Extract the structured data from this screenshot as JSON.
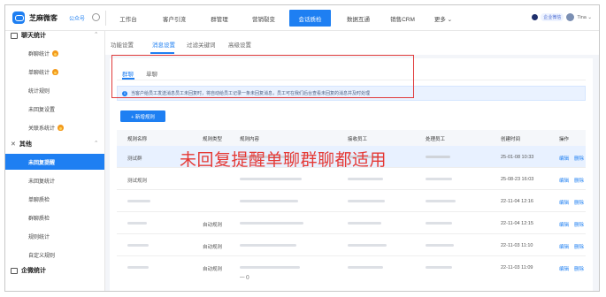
{
  "header": {
    "brand": "芝麻微客",
    "account_label": "公众号",
    "nav": [
      "工作台",
      "客户引流",
      "群管理",
      "营销裂变",
      "会话质检",
      "数据互通",
      "销售CRM",
      "更多 ⌄"
    ],
    "active_nav": "会话质检",
    "enterprise_badge": "企业微信",
    "user_name": "Tina ⌄"
  },
  "sidebar": {
    "top_group": "聊天统计",
    "top_items": [
      "群聊统计",
      "单聊统计",
      "统计规则",
      "未回复设置",
      "关联系统计"
    ],
    "group_other": "其他",
    "other_items": [
      "未回复提醒",
      "未回复统计",
      "单聊质检",
      "群聊质检",
      "规则统计",
      "自定义规则"
    ],
    "group_enterprise": "企微统计",
    "active_item": "未回复提醒"
  },
  "subtabs": [
    "功能设置",
    "消息设置",
    "过滤关键词",
    "高级设置"
  ],
  "panel": {
    "inner_tabs": [
      "群聊",
      "单聊"
    ],
    "notice": "当客户给员工发送消息员工未回复时，将自动给员工记录一条未回复消息，员工可在我们后台查看未回复的消息并及时处理",
    "add_button": "+ 新增规则",
    "columns": [
      "规则名称",
      "规则类型",
      "规则内容",
      "接收员工",
      "处理员工",
      "创建时间",
      "操作"
    ],
    "rows": [
      {
        "name": "测试群",
        "type": "",
        "created": "25-01-08 10:33",
        "edit": "编辑",
        "del": "删除"
      },
      {
        "name": "测试规则",
        "type": "",
        "created": "25-08-23 16:03",
        "edit": "编辑",
        "del": "删除"
      },
      {
        "name": "",
        "type": "",
        "created": "22-11-04 12:16",
        "edit": "编辑",
        "del": "删除"
      },
      {
        "name": "",
        "type": "自动规则",
        "created": "22-11-04 12:15",
        "edit": "编辑",
        "del": "删除"
      },
      {
        "name": "",
        "type": "自动规则",
        "created": "22-11-03 11:10",
        "edit": "编辑",
        "del": "删除"
      },
      {
        "name": "",
        "type": "自动规则",
        "created": "22-11-03 11:09",
        "edit": "编辑",
        "del": "删除"
      }
    ],
    "trailing_text": "— ()"
  },
  "annotation": "未回复提醒单聊群聊都适用",
  "colors": {
    "accent": "#1e7ff2",
    "annotation": "#e53935"
  }
}
